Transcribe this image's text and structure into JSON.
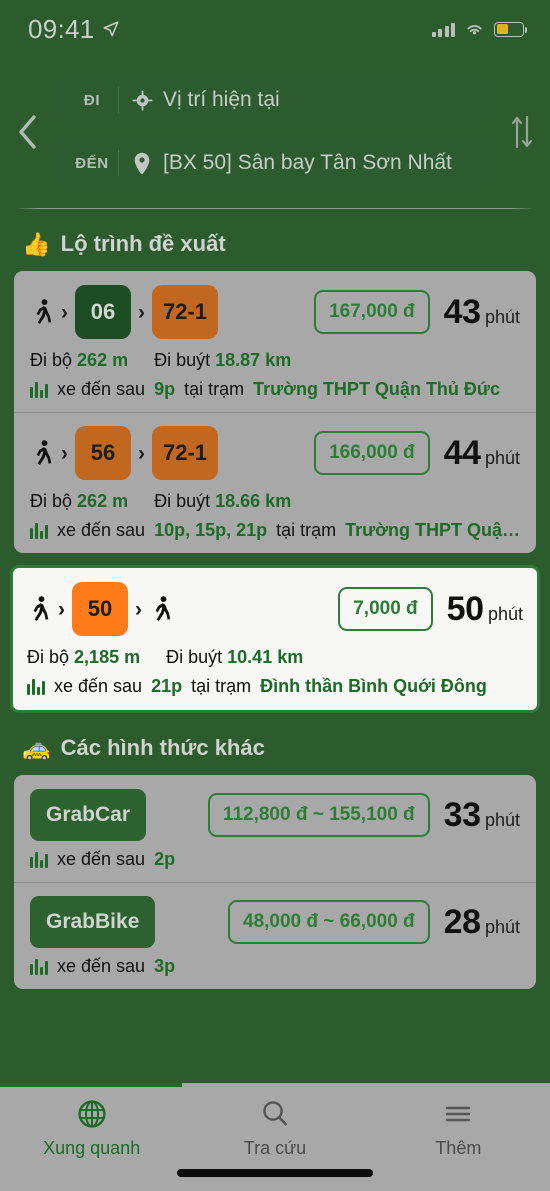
{
  "statusbar": {
    "time": "09:41",
    "location_icon": "navigation-arrow-icon",
    "signal_icon": "cellular-bars-icon",
    "wifi_icon": "wifi-icon",
    "battery_icon": "battery-low-icon"
  },
  "header": {
    "back_icon": "chevron-left-icon",
    "swap_icon": "swap-vertical-icon",
    "origin": {
      "tag": "ĐI",
      "icon": "current-location-icon",
      "value": "Vị trí hiện tại"
    },
    "destination": {
      "tag": "ĐẾN",
      "icon": "map-pin-icon",
      "value": "[BX 50] Sân bay Tân Sơn Nhất"
    }
  },
  "sections": [
    {
      "emoji": "👍",
      "title": "Lộ trình đề xuất"
    },
    {
      "emoji": "🚕",
      "title": "Các hình thức khác"
    }
  ],
  "routes": [
    {
      "legs": [
        {
          "type": "walk",
          "icon": "walking-person-icon"
        },
        {
          "type": "bus",
          "label": "06",
          "color": "green"
        },
        {
          "type": "bus",
          "label": "72-1",
          "color": "brown"
        }
      ],
      "price": "167,000 đ",
      "duration": "43",
      "duration_unit": "phút",
      "walk_label": "Đi bộ",
      "walk_value": "262 m",
      "bus_label": "Đi buýt",
      "bus_value": "18.87 km",
      "arrival_prefix": "xe đến sau",
      "arrival_times": "9p",
      "arrival_mid": "tại trạm",
      "stop": "Trường THPT Quận Thủ Đức",
      "selected": false
    },
    {
      "legs": [
        {
          "type": "walk",
          "icon": "walking-person-icon"
        },
        {
          "type": "bus",
          "label": "56",
          "color": "brown"
        },
        {
          "type": "bus",
          "label": "72-1",
          "color": "brown"
        }
      ],
      "price": "166,000 đ",
      "duration": "44",
      "duration_unit": "phút",
      "walk_label": "Đi bộ",
      "walk_value": "262 m",
      "bus_label": "Đi buýt",
      "bus_value": "18.66 km",
      "arrival_prefix": "xe đến sau",
      "arrival_times": "10p, 15p, 21p",
      "arrival_mid": "tại trạm",
      "stop": "Trường THPT Quậ…",
      "selected": false
    },
    {
      "legs": [
        {
          "type": "walk",
          "icon": "walking-person-icon"
        },
        {
          "type": "bus",
          "label": "50",
          "color": "orange"
        },
        {
          "type": "walk",
          "icon": "walking-person-icon"
        }
      ],
      "price": "7,000 đ",
      "duration": "50",
      "duration_unit": "phút",
      "walk_label": "Đi bộ",
      "walk_value": "2,185 m",
      "bus_label": "Đi buýt",
      "bus_value": "10.41 km",
      "arrival_prefix": "xe đến sau",
      "arrival_times": "21p",
      "arrival_mid": "tại trạm",
      "stop": "Đình thần Bình Quới Đông",
      "selected": true
    }
  ],
  "other_options": [
    {
      "name": "GrabCar",
      "price": "112,800 đ ~ 155,100 đ",
      "duration": "33",
      "duration_unit": "phút",
      "arrival_prefix": "xe đến sau",
      "arrival_times": "2p"
    },
    {
      "name": "GrabBike",
      "price": "48,000 đ ~ 66,000 đ",
      "duration": "28",
      "duration_unit": "phút",
      "arrival_prefix": "xe đến sau",
      "arrival_times": "3p"
    }
  ],
  "tabs": [
    {
      "label": "Xung quanh",
      "icon": "globe-icon",
      "active": true
    },
    {
      "label": "Tra cứu",
      "icon": "search-icon",
      "active": false
    },
    {
      "label": "Thêm",
      "icon": "hamburger-menu-icon",
      "active": false
    }
  ],
  "colors": {
    "brand_green": "#2c5c2e",
    "accent_green": "#1d6b27",
    "card_gray": "#a8a8a8",
    "orange": "#ff7a18",
    "brown": "#c2671f",
    "battery_yellow": "#ddb41f"
  }
}
